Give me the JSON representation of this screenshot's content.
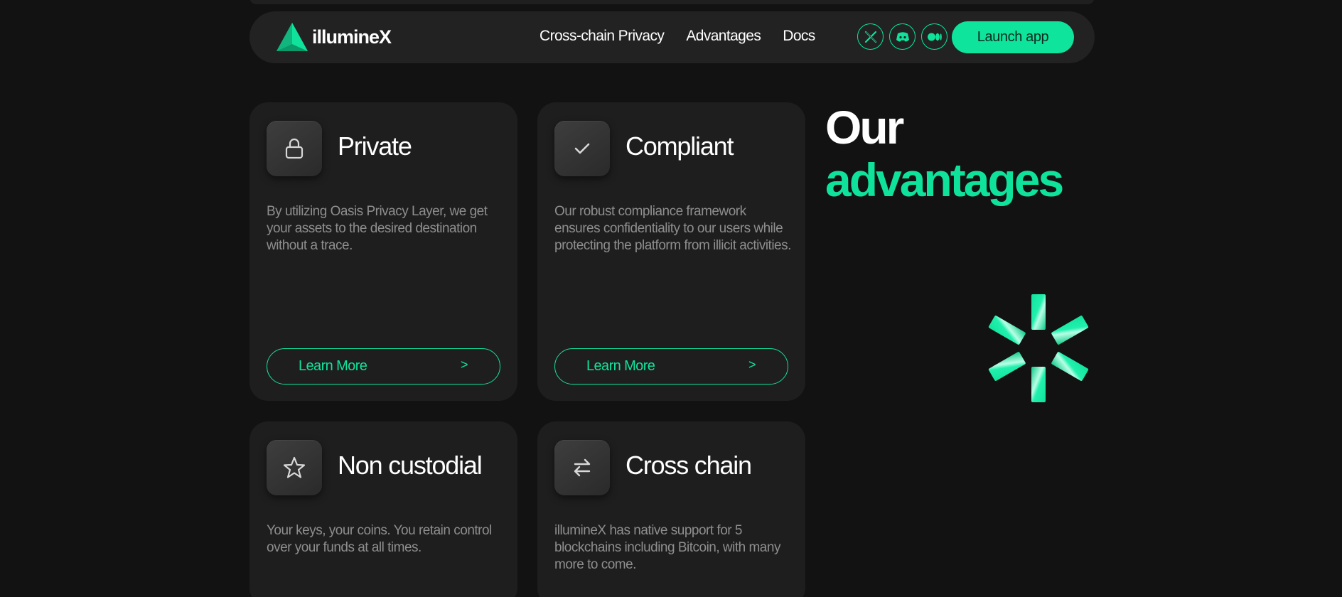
{
  "brand": {
    "name": "illumineX",
    "accent": "#0fe39b",
    "logo_icon": "triangle-logo-icon"
  },
  "nav": {
    "links": [
      "Cross-chain Privacy",
      "Advantages",
      "Docs"
    ],
    "socials": [
      {
        "name": "x-icon"
      },
      {
        "name": "discord-icon"
      },
      {
        "name": "medium-icon"
      }
    ],
    "launch_label": "Launch app"
  },
  "cards": [
    {
      "icon": "lock-icon",
      "title": "Private",
      "description": "By utilizing Oasis Privacy Layer, we get your assets to the desired destination without a trace.",
      "button_label": "Learn More",
      "button_arrow": ">"
    },
    {
      "icon": "checkmark-icon",
      "title": "Compliant",
      "description": "Our robust compliance framework ensures confidentiality to our users while protecting the platform from illicit activities.",
      "button_label": "Learn More",
      "button_arrow": ">"
    },
    {
      "icon": "star-icon",
      "title": "Non custodial",
      "description": "Your keys, your coins. You retain control over your funds at all times."
    },
    {
      "icon": "swap-arrows-icon",
      "title": "Cross chain",
      "description": "illumineX has native support for 5 blockchains including Bitcoin, with many more to come."
    }
  ],
  "heading": {
    "line1": "Our",
    "line2": "advantages"
  },
  "decor": {
    "icon": "asterisk-3d-icon"
  }
}
